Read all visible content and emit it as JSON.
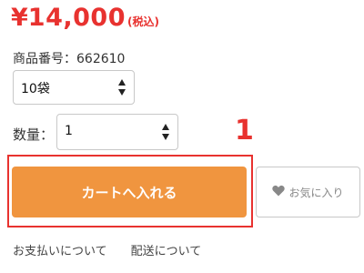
{
  "price": {
    "currency": "¥",
    "amount": "14,000",
    "tax_note": "(税込)"
  },
  "product": {
    "number_label": "商品番号：662610"
  },
  "variant_select": {
    "value": "10袋"
  },
  "quantity": {
    "label": "数量：",
    "value": "1"
  },
  "step": {
    "number": "1"
  },
  "actions": {
    "cart_label": "カートへ入れる",
    "favorite_label": "お気に入り"
  },
  "links": {
    "payment": "お支払いについて",
    "shipping": "配送について"
  },
  "colors": {
    "accent_red": "#e8322f",
    "cart_orange": "#f0953f",
    "heart_gray": "#888888"
  },
  "icons": {
    "spinner": "up-down-arrows-icon",
    "favorite": "heart-icon"
  }
}
